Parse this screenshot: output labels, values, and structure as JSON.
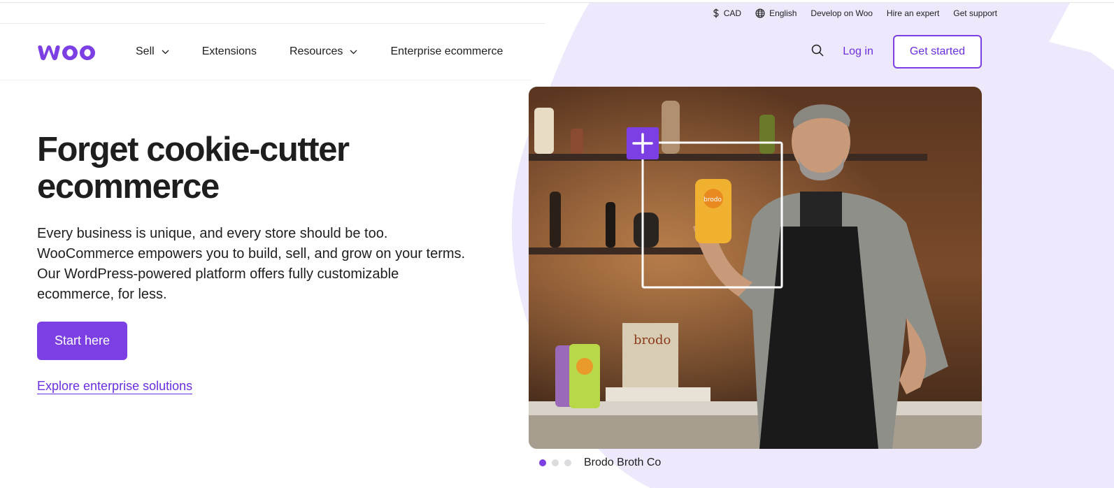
{
  "colors": {
    "accent": "#7b3fe4",
    "link": "#6b2fe0",
    "blob": "#ede8fc",
    "text": "#1e1e1e"
  },
  "utility": {
    "currency": {
      "icon": "dollar-icon",
      "label": "CAD"
    },
    "language": {
      "icon": "globe-icon",
      "label": "English"
    },
    "links": [
      "Develop on Woo",
      "Hire an expert",
      "Get support"
    ]
  },
  "nav": {
    "logo_text": "woo",
    "items": [
      {
        "label": "Sell",
        "has_dropdown": true
      },
      {
        "label": "Extensions",
        "has_dropdown": false
      },
      {
        "label": "Resources",
        "has_dropdown": true
      },
      {
        "label": "Enterprise ecommerce",
        "has_dropdown": false
      }
    ],
    "login": "Log in",
    "cta": "Get started"
  },
  "hero": {
    "title_line1": "Forget cookie-cutter",
    "title_line2": "ecommerce",
    "description": "Every business is unique, and every store should be too. WooCommerce empowers you to build, sell, and grow on your terms. Our WordPress-powered platform offers fully customizable ecommerce, for less.",
    "primary_button": "Start here",
    "secondary_link": "Explore enterprise solutions"
  },
  "carousel": {
    "slide_count": 3,
    "active_index": 0,
    "caption": "Brodo Broth Co",
    "image_text": {
      "product_label": "brodo",
      "book_title": "brodo"
    }
  }
}
